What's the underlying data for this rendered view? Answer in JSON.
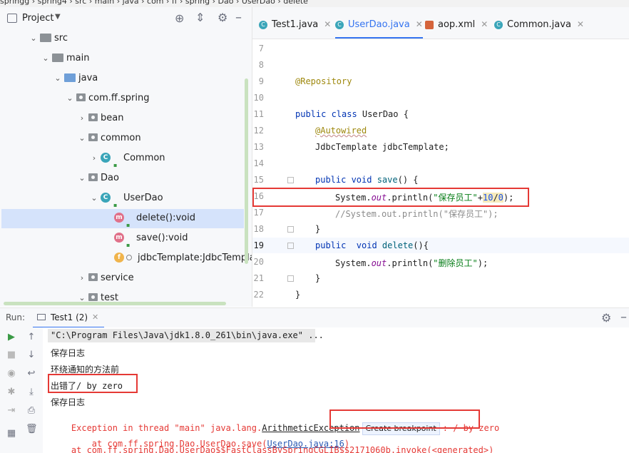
{
  "breadcrumb": {
    "text": "springg  ›  spring4  ›  src  ›  main  ›  java  ›  com  ›  ff  ›  spring  ›  Dao  ›  UserDao  ›  delete"
  },
  "project": {
    "title": "Project",
    "tree": [
      {
        "label": "src",
        "depth": 0,
        "expanded": true,
        "icon": "folder"
      },
      {
        "label": "main",
        "depth": 1,
        "expanded": true,
        "icon": "folder"
      },
      {
        "label": "java",
        "depth": 2,
        "expanded": true,
        "icon": "folder-source"
      },
      {
        "label": "com.ff.spring",
        "depth": 3,
        "expanded": true,
        "icon": "package"
      },
      {
        "label": "bean",
        "depth": 4,
        "expanded": false,
        "icon": "package"
      },
      {
        "label": "common",
        "depth": 4,
        "expanded": true,
        "icon": "package"
      },
      {
        "label": "Common",
        "depth": 5,
        "expanded": false,
        "icon": "class"
      },
      {
        "label": "Dao",
        "depth": 4,
        "expanded": true,
        "icon": "package"
      },
      {
        "label": "UserDao",
        "depth": 5,
        "expanded": true,
        "icon": "class"
      },
      {
        "label": "delete():void",
        "depth": 6,
        "icon": "method",
        "selected": true
      },
      {
        "label": "save():void",
        "depth": 6,
        "icon": "method"
      },
      {
        "label": "jdbcTemplate:JdbcTemplate",
        "depth": 6,
        "icon": "field"
      },
      {
        "label": "service",
        "depth": 4,
        "expanded": false,
        "icon": "package"
      },
      {
        "label": "test",
        "depth": 4,
        "expanded": true,
        "icon": "package"
      }
    ]
  },
  "tabs": [
    {
      "label": "Test1.java",
      "icon": "java-class-icon",
      "active": false
    },
    {
      "label": "UserDao.java",
      "icon": "java-class-icon",
      "active": true
    },
    {
      "label": "aop.xml",
      "icon": "xml-file-icon",
      "active": false
    },
    {
      "label": "Common.java",
      "icon": "java-class-icon",
      "active": false
    }
  ],
  "editor": {
    "line_numbers": [
      "7",
      "8",
      "9",
      "10",
      "11",
      "12",
      "13",
      "14",
      "15",
      "16",
      "17",
      "18",
      "19",
      "20",
      "21",
      "22"
    ],
    "lines": {
      "l9": "@Repository",
      "l11a": "public class ",
      "l11b": "UserDao",
      "l11c": " {",
      "l12": "@Autowired",
      "l13": "JdbcTemplate jdbcTemplate;",
      "l15a": "public void ",
      "l15b": "save",
      "l15c": "() {",
      "l16a": "System.",
      "l16b": "out",
      "l16c": ".println(",
      "l16d": "\"保存员工\"",
      "l16e": "+",
      "l16f": "10",
      "l16g": "/",
      "l16h": "0",
      "l16i": ");",
      "l17": "//System.out.println(\"保存员工\");",
      "l18": "}",
      "l19a": "public  void ",
      "l19b": "delete",
      "l19c": "(){",
      "l20a": "System.",
      "l20b": "out",
      "l20c": ".println(",
      "l20d": "\"删除员工\"",
      "l20e": ");",
      "l21": "}",
      "l22": "}"
    }
  },
  "run": {
    "label": "Run:",
    "tab_label": "Test1 (2)",
    "console": {
      "cmd": "\"C:\\Program Files\\Java\\jdk1.8.0_261\\bin\\java.exe\" ...",
      "line1": "保存日志",
      "line2": "环绕通知的方法前",
      "line3": "出错了/ by zero",
      "line4": "保存日志",
      "exc_prefix": "Exception in thread \"main\" java.lang.",
      "exc_class": "ArithmeticException",
      "create_breakpoint": "Create breakpoint",
      "exc_suffix": ": / by zero",
      "at1_prefix": "    at com.ff.spring.Dao.UserDao.save(",
      "at1_link": "UserDao.java:16",
      "at1_suffix": ")",
      "at2": "    at com.ff.spring.Dao.UserDao$$FastClassBySpringCGLIB$$2171060b.invoke(<generated>)"
    }
  },
  "colors": {
    "accent": "#3574f0",
    "highlight_box": "#e53935",
    "error_text": "#e53935",
    "selection": "#d5e3fb"
  }
}
